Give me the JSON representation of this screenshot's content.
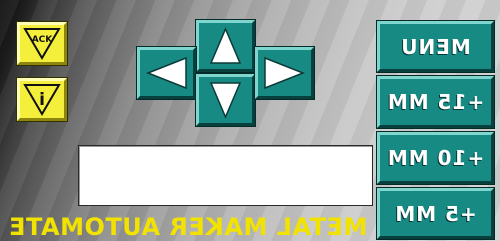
{
  "panel": {
    "title": "METAL MAKER AUTOMATE",
    "title_mirrored": true,
    "display_text": ""
  },
  "buttons": {
    "ack": {
      "label": "ACK",
      "icon": "ack-triangle-icon"
    },
    "info": {
      "label": "i",
      "icon": "info-triangle-icon"
    },
    "arrows": [
      "arrow-up-icon",
      "arrow-left-icon",
      "arrow-down-icon",
      "arrow-right-icon"
    ],
    "menu": [
      {
        "label": "MENU"
      },
      {
        "label": "+15 MM"
      },
      {
        "label": "+10 MM"
      },
      {
        "label": "+5 MM"
      }
    ]
  },
  "colors": {
    "yellow_button": "#f4ef3a",
    "teal_button": "#188a84",
    "title_text": "#f2e200",
    "menu_text": "#ffffff"
  }
}
